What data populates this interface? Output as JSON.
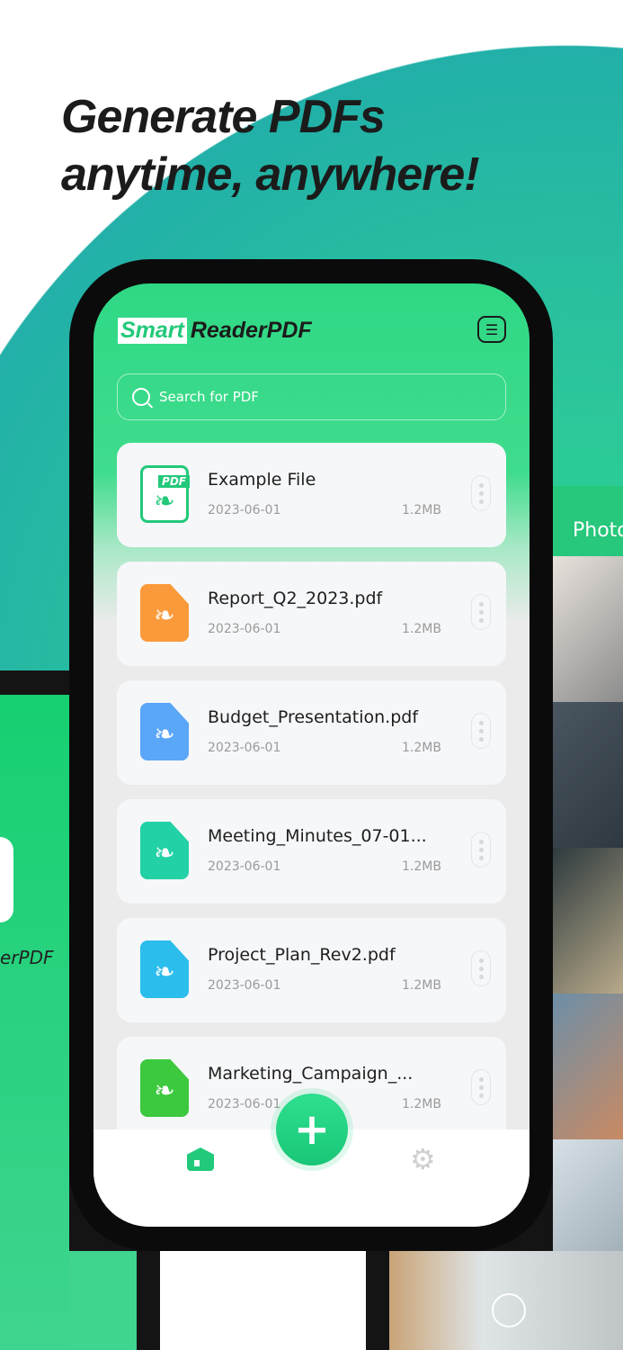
{
  "headline": {
    "line1": "Generate PDFs",
    "line2": "anytime, anywhere!"
  },
  "app": {
    "logo_smart": "Smart",
    "logo_rest": "ReaderPDF",
    "search_placeholder": "Search for PDF"
  },
  "files": [
    {
      "name": "Example File",
      "date": "2023-06-01",
      "size": "1.2MB",
      "color": "#ffffff"
    },
    {
      "name": "Report_Q2_2023.pdf",
      "date": "2023-06-01",
      "size": "1.2MB",
      "color": "#fb9a3a"
    },
    {
      "name": "Budget_Presentation.pdf",
      "date": "2023-06-01",
      "size": "1.2MB",
      "color": "#5aa6f7"
    },
    {
      "name": "Meeting_Minutes_07-01...",
      "date": "2023-06-01",
      "size": "1.2MB",
      "color": "#22d1a6"
    },
    {
      "name": "Project_Plan_Rev2.pdf",
      "date": "2023-06-01",
      "size": "1.2MB",
      "color": "#2bbdec"
    },
    {
      "name": "Marketing_Campaign_...",
      "date": "2023-06-01",
      "size": "1.2MB",
      "color": "#3cc93e"
    }
  ],
  "pdf_tag": "PDF",
  "fab_label": "+",
  "side": {
    "left_label": "erPDF",
    "right_header": "Photo"
  },
  "colors": {
    "accent": "#22c97a"
  }
}
